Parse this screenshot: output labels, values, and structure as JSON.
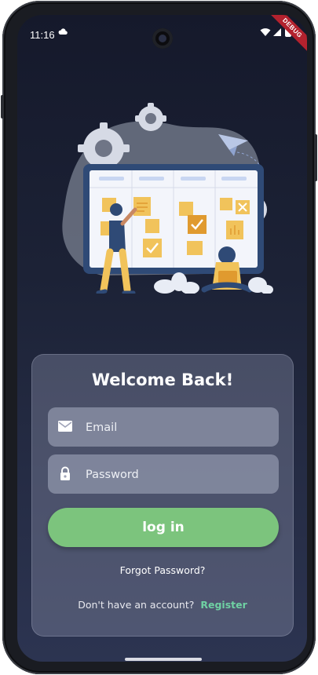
{
  "status_bar": {
    "time": "11:16",
    "debug_banner": "DEBUG"
  },
  "login": {
    "title": "Welcome Back!",
    "email_placeholder": "Email",
    "password_placeholder": "Password",
    "login_button": "log in",
    "forgot_password": "Forgot Password?",
    "no_account_text": "Don't have an account?",
    "register_link": "Register"
  },
  "icons": {
    "email": "mail-icon",
    "password": "lock-icon"
  },
  "colors": {
    "login_button": "#7cc47d",
    "register_link": "#6fd1a3",
    "debug_banner": "#b3222e"
  }
}
